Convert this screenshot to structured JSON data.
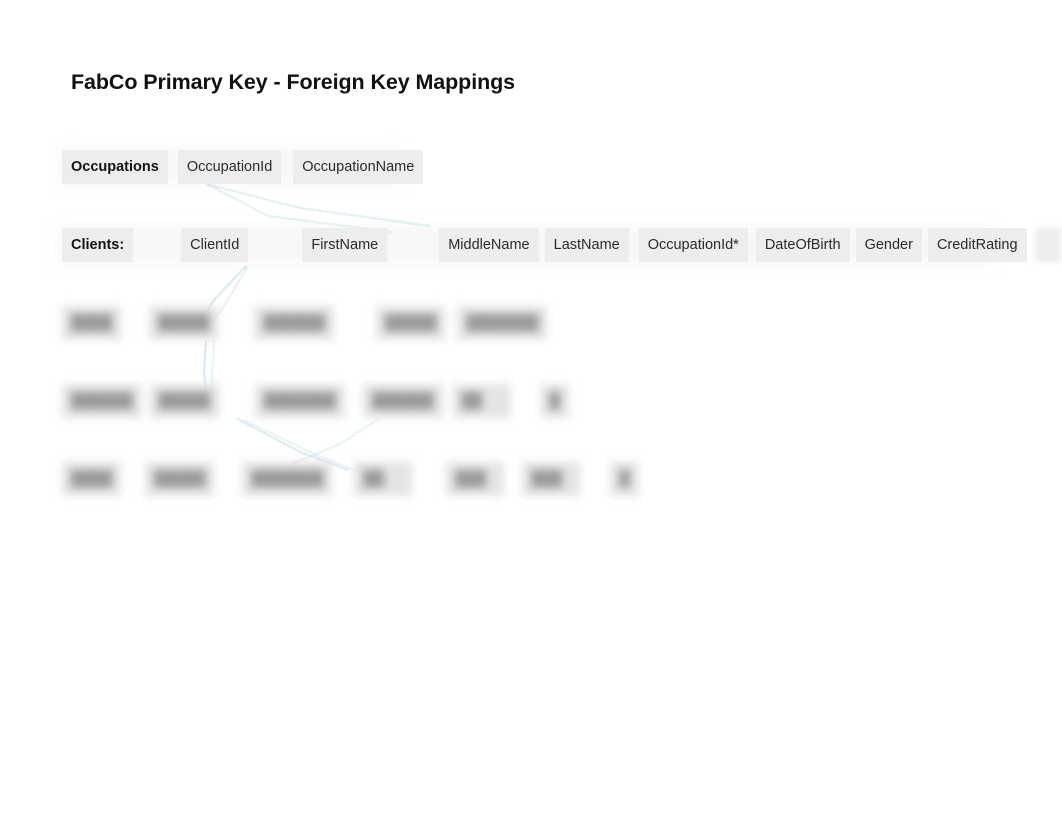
{
  "page": {
    "title": "FabCo Primary Key - Foreign Key Mappings",
    "background_color": "#ffffff",
    "connector_color": "#cfe2ea"
  },
  "tables": {
    "occupations": {
      "label": "Occupations",
      "columns": [
        "OccupationId",
        "OccupationName"
      ]
    },
    "clients": {
      "label": "Clients:",
      "columns": [
        "ClientId",
        "FirstName",
        "MiddleName",
        "LastName",
        "OccupationId*",
        "DateOfBirth",
        "Gender",
        "CreditRating"
      ],
      "trailing_redacted_cells": 2
    }
  },
  "data_rows": [
    {
      "id": "row-1",
      "redacted": true,
      "cells": [
        "████",
        "█████",
        "██████",
        "█████",
        "███████"
      ]
    },
    {
      "id": "row-2",
      "redacted": true,
      "cells": [
        "██████",
        "█████",
        "███████",
        "██████",
        "██",
        "█"
      ]
    },
    {
      "id": "row-3",
      "redacted": true,
      "cells": [
        "████",
        "█████",
        "███████",
        "██",
        "███",
        "███",
        "█"
      ]
    }
  ],
  "relationships": [
    {
      "name": "occupationid-to-occupationid-fk",
      "from": "Occupations.OccupationId",
      "to": "Clients.OccupationId*"
    }
  ]
}
